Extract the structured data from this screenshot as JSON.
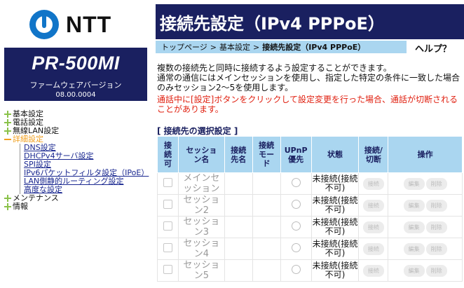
{
  "brand": {
    "logo_text": "NTT"
  },
  "product": {
    "name": "PR-500MI",
    "fw_label": "ファームウェアバージョン",
    "fw_version": "08.00.0004"
  },
  "nav": {
    "basic": "基本設定",
    "phone": "電話設定",
    "wireless": "無線LAN設定",
    "advanced": "詳細設定",
    "sub": [
      "DNS設定",
      "DHCPv4サーバ設定",
      "SPI設定",
      "IPv6パケットフィルタ設定（IPoE）",
      "LAN側静的ルーティング設定",
      "高度な設定"
    ],
    "maintenance": "メンテナンス",
    "info": "情報"
  },
  "header": {
    "title": "接続先設定（IPv4 PPPoE）"
  },
  "breadcrumb": {
    "top": "トップページ",
    "sep": ">",
    "basic": "基本設定",
    "current": "接続先設定（IPv4 PPPoE）"
  },
  "help": {
    "label": "ヘルプ？"
  },
  "description": {
    "line1": "複数の接続先と同時に接続するよう設定することができます。",
    "line2": "通常の通信にはメインセッションを使用し、指定した特定の条件に一致した場合のみセッション2～5を使用します。"
  },
  "warning": "通話中に[設定]ボタンをクリックして設定変更を行った場合、通話が切断されることがあります。",
  "section_title": "[ 接続先の選択設定 ]",
  "table": {
    "headers": [
      "接続可",
      "セッション名",
      "接続先名",
      "接続モード",
      "UPnP優先",
      "状態",
      "接続/切断",
      "操作"
    ],
    "rows": [
      {
        "session": "メインセッション",
        "state": "未接続(接続不可)"
      },
      {
        "session": "セッション2",
        "state": "未接続(接続不可)"
      },
      {
        "session": "セッション3",
        "state": "未接続(接続不可)"
      },
      {
        "session": "セッション4",
        "state": "未接続(接続不可)"
      },
      {
        "session": "セッション5",
        "state": "未接続(接続不可)"
      }
    ],
    "btn_connect": "接続",
    "btn_edit": "編集",
    "btn_delete": "削除"
  },
  "colors": {
    "navy": "#1a2060",
    "light_blue": "#aad6f0",
    "warning_red": "#e02010",
    "nav_green": "#8ac24a",
    "nav_orange": "#f0a020"
  }
}
